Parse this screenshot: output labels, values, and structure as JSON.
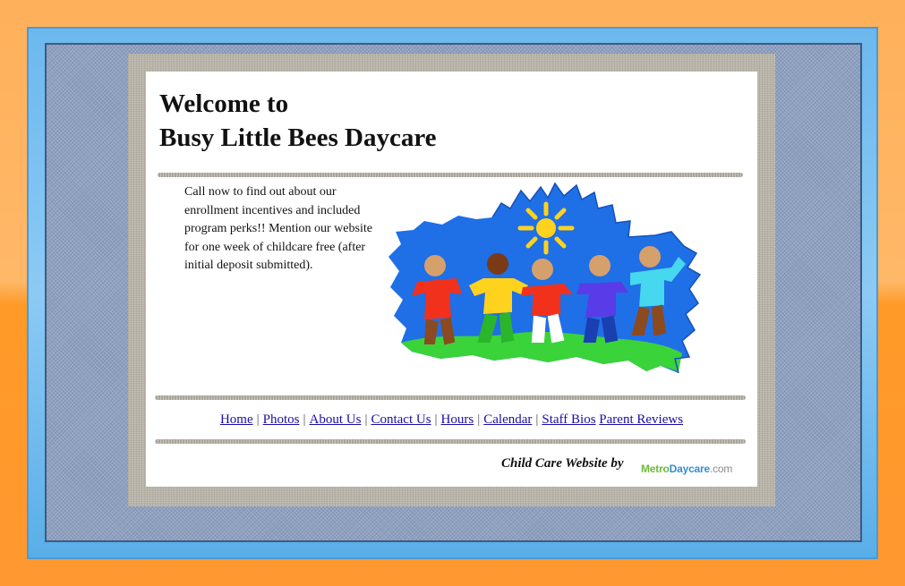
{
  "page": {
    "title_line1": "Welcome to",
    "title_line2": "Busy Little Bees Daycare"
  },
  "promo": {
    "text": "Call now to find out about our enrollment incentives and included program perks!! Mention our website for one week of childcare free (after initial deposit submitted)."
  },
  "nav": {
    "items": [
      {
        "label": "Home"
      },
      {
        "label": "Photos"
      },
      {
        "label": "About Us"
      },
      {
        "label": "Contact Us"
      },
      {
        "label": "Hours"
      },
      {
        "label": "Calendar"
      },
      {
        "label": "Staff Bios"
      },
      {
        "label": "Parent Reviews"
      }
    ],
    "separator": "|"
  },
  "footer": {
    "credit": "Child Care Website by",
    "logo_part1": "Metro",
    "logo_part2": "Daycare",
    "logo_part3": ".com"
  },
  "colors": {
    "page_bg": "#ffa848",
    "link": "#1a0dab",
    "art_blue": "#1f6fe6",
    "art_grass": "#3ad33a",
    "sun": "#ffd21e"
  },
  "icons": {
    "hero": "children-holding-hands-illustration",
    "sun": "sun-icon"
  }
}
